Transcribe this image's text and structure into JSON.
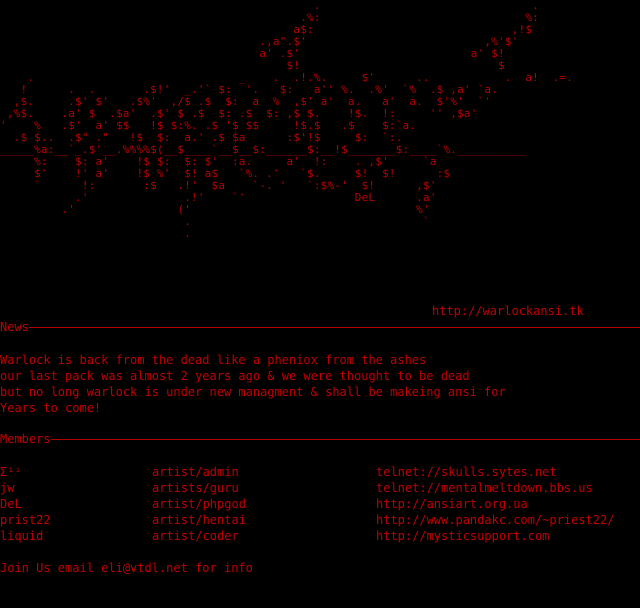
{
  "logo": {
    "art": "                                              .                               .\n                                            .%:                              %:\n                                           a$:                             ,!$\n                                      .,a\".$'                          ,%'$'\n                                      a' .$'                         a' $!\n                                          $!                             $\n    .                              _    .  .!.%.     $'      ..           .  a!  .=.\n   !      .  .       .$!'  _.'` $:  '.   $:   a'' %.  .%'  `%  .$ ,a' `a.\n  ,$.     .$' $'   .$%'  ,/$ .$  $:  a  %  ,$' a'  a.   a'  a.  $'%'  `'\n ,%$.    .a' $  .$a'  .$' $ .$  $: .$  $: ,$ $.    !$.  !:     '' ,$a'\n'    %   .$'  a' $$   !$ $:%. .$ '$ $$     !$.$   .$    $:`a.\n  .$ $..  .$\" .\"   !$  $:  a.' .$ $a      :$'!$     $:  `:.\n_____%a:__`_.$'__.%%%%$(__$____`__$__$:______$:__!$_______$:____`%.__________\n     %:    $: a'    !$ $:  $: $'  :a.     a'  !:    . ,$'     `a\n     $'    !' a'    !$ %'  $! a$   `%. .'   `$.     $!  $!      :$\n     `      !:       :$   .!'  $a    `-. '   `:$%-'  $!      ,$'\n           .'              .!'    `'                DeL      .a'\n         .'               ('                                 %'\n                           .                                  `\n                           ."
  },
  "url": "http://warlockansi.tk",
  "news": {
    "heading": "News",
    "lines": [
      "Warlock is back from the dead like a pheniox from the ashes",
      "our last pack was almost 2 years ago & we were thought to be dead",
      "but no long warlock is under new managment & shall be makeing ansi for",
      "Years to come!"
    ]
  },
  "members": {
    "heading": "Members",
    "rows": [
      {
        "name": "Σ¹ⁱ",
        "role": "artist/admin",
        "link": "telnet://skulls.sytes.net"
      },
      {
        "name": "jw",
        "role": "artists/guru",
        "link": "telnet://mentalmeltdown.bbs.us"
      },
      {
        "name": "DeL",
        "role": "artist/phpgod",
        "link": "http://ansiart.org.ua"
      },
      {
        "name": "prist22",
        "role": "artist/hentai",
        "link": "http://www.pandakc.com/~priest22/"
      },
      {
        "name": "liquid",
        "role": "artist/coder",
        "link": "http://mysticsupport.com"
      }
    ]
  },
  "join": "Join Us email eli@vtdl.net for info",
  "colors": {
    "background": "#000000",
    "text": "#c00000"
  }
}
